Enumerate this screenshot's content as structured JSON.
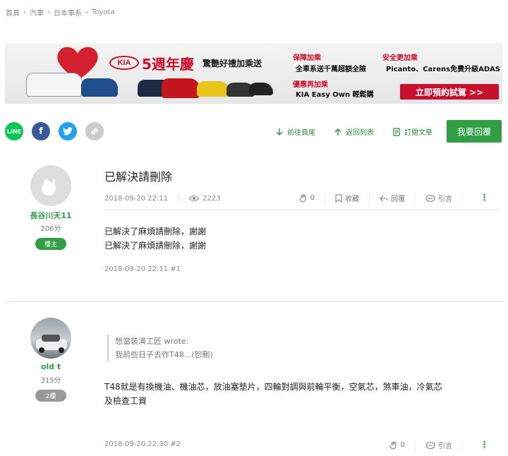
{
  "breadcrumb": [
    "首頁",
    "汽車",
    "日本車系",
    "Toyota"
  ],
  "banner": {
    "brand": "KIA",
    "anniversary": "5週年慶",
    "tagline": "驚艷好禮加乘送",
    "promo1_head": "保障加乘",
    "promo1_text": "全車系送千萬超額全險",
    "promo2_head": "安全更加乘",
    "promo2_text": "Picanto、Carens免費升級ADAS",
    "promo3_head": "優惠再加乘",
    "promo3_text": "KIA Easy Own 輕鬆購",
    "cta": "立即預約試駕 >>"
  },
  "share": {
    "line": "LINE",
    "facebook": "f",
    "twitter": "t",
    "link": "🔗"
  },
  "toolbar": {
    "last_page": "前往頁尾",
    "back_list": "返回列表",
    "subscribe": "訂閱文章",
    "reply": "我要回覆"
  },
  "post1": {
    "title": "已解決請刪除",
    "datetime": "2018-09-20 22:11",
    "views": "2223",
    "likes": "0",
    "favorite": "收藏",
    "reply": "回覆",
    "quote": "引言",
    "author": "長谷川天11",
    "points": "206分",
    "floor": "樓主",
    "body_line1": "已解決了麻煩請刪除，謝謝",
    "body_line2": "已解決了麻煩請刪除，謝謝",
    "footer": "2018-09-20 22:11 #1"
  },
  "post2": {
    "author": "old t",
    "points": "315分",
    "floor": "2樓",
    "quote_author": "想當裝潢工匠 wrote:",
    "quote_text": "我前些日子去作T48...(恕刪)",
    "body_line1": "T48就是有換機油、機油芯，放油塞墊片，四輪對調與前輪平衡，空氣芯，煞車油，冷氣芯",
    "body_line2": "及檢查工資",
    "footer": "2018-09-20 22:30 #2",
    "likes": "0",
    "quote": "引言"
  },
  "colors": {
    "accent": "#2f9e44",
    "kia_red": "#c8102e",
    "line_green": "#06c755",
    "facebook": "#3b5998",
    "twitter": "#1da1f2"
  }
}
